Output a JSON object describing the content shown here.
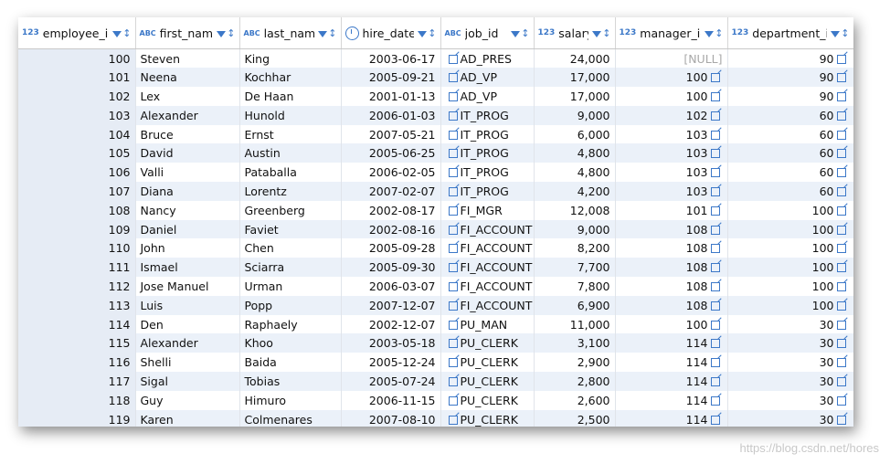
{
  "table": {
    "columns": [
      {
        "name": "employee_id",
        "type_icon": "123",
        "icon_kind": "numeric-type-icon"
      },
      {
        "name": "first_name",
        "type_icon": "ABC",
        "icon_kind": "text-type-icon"
      },
      {
        "name": "last_name",
        "type_icon": "ABC",
        "icon_kind": "text-key-type-icon"
      },
      {
        "name": "hire_date",
        "type_icon": "",
        "icon_kind": "clock-icon"
      },
      {
        "name": "job_id",
        "type_icon": "ABC",
        "icon_kind": "text-key-type-icon"
      },
      {
        "name": "salary",
        "type_icon": "123",
        "icon_kind": "numeric-type-icon"
      },
      {
        "name": "manager_id",
        "type_icon": "123",
        "icon_kind": "numeric-key-type-icon"
      },
      {
        "name": "department_id",
        "type_icon": "123",
        "icon_kind": "numeric-key-type-icon"
      }
    ],
    "rows": [
      {
        "employee_id": "100",
        "first_name": "Steven",
        "last_name": "King",
        "hire_date": "2003-06-17",
        "job_id": "AD_PRES",
        "salary": "24,000",
        "manager_id": "[NULL]",
        "department_id": "90"
      },
      {
        "employee_id": "101",
        "first_name": "Neena",
        "last_name": "Kochhar",
        "hire_date": "2005-09-21",
        "job_id": "AD_VP",
        "salary": "17,000",
        "manager_id": "100",
        "department_id": "90"
      },
      {
        "employee_id": "102",
        "first_name": "Lex",
        "last_name": "De Haan",
        "hire_date": "2001-01-13",
        "job_id": "AD_VP",
        "salary": "17,000",
        "manager_id": "100",
        "department_id": "90"
      },
      {
        "employee_id": "103",
        "first_name": "Alexander",
        "last_name": "Hunold",
        "hire_date": "2006-01-03",
        "job_id": "IT_PROG",
        "salary": "9,000",
        "manager_id": "102",
        "department_id": "60"
      },
      {
        "employee_id": "104",
        "first_name": "Bruce",
        "last_name": "Ernst",
        "hire_date": "2007-05-21",
        "job_id": "IT_PROG",
        "salary": "6,000",
        "manager_id": "103",
        "department_id": "60"
      },
      {
        "employee_id": "105",
        "first_name": "David",
        "last_name": "Austin",
        "hire_date": "2005-06-25",
        "job_id": "IT_PROG",
        "salary": "4,800",
        "manager_id": "103",
        "department_id": "60"
      },
      {
        "employee_id": "106",
        "first_name": "Valli",
        "last_name": "Pataballa",
        "hire_date": "2006-02-05",
        "job_id": "IT_PROG",
        "salary": "4,800",
        "manager_id": "103",
        "department_id": "60"
      },
      {
        "employee_id": "107",
        "first_name": "Diana",
        "last_name": "Lorentz",
        "hire_date": "2007-02-07",
        "job_id": "IT_PROG",
        "salary": "4,200",
        "manager_id": "103",
        "department_id": "60"
      },
      {
        "employee_id": "108",
        "first_name": "Nancy",
        "last_name": "Greenberg",
        "hire_date": "2002-08-17",
        "job_id": "FI_MGR",
        "salary": "12,008",
        "manager_id": "101",
        "department_id": "100"
      },
      {
        "employee_id": "109",
        "first_name": "Daniel",
        "last_name": "Faviet",
        "hire_date": "2002-08-16",
        "job_id": "FI_ACCOUNT",
        "salary": "9,000",
        "manager_id": "108",
        "department_id": "100"
      },
      {
        "employee_id": "110",
        "first_name": "John",
        "last_name": "Chen",
        "hire_date": "2005-09-28",
        "job_id": "FI_ACCOUNT",
        "salary": "8,200",
        "manager_id": "108",
        "department_id": "100"
      },
      {
        "employee_id": "111",
        "first_name": "Ismael",
        "last_name": "Sciarra",
        "hire_date": "2005-09-30",
        "job_id": "FI_ACCOUNT",
        "salary": "7,700",
        "manager_id": "108",
        "department_id": "100"
      },
      {
        "employee_id": "112",
        "first_name": "Jose Manuel",
        "last_name": "Urman",
        "hire_date": "2006-03-07",
        "job_id": "FI_ACCOUNT",
        "salary": "7,800",
        "manager_id": "108",
        "department_id": "100"
      },
      {
        "employee_id": "113",
        "first_name": "Luis",
        "last_name": "Popp",
        "hire_date": "2007-12-07",
        "job_id": "FI_ACCOUNT",
        "salary": "6,900",
        "manager_id": "108",
        "department_id": "100"
      },
      {
        "employee_id": "114",
        "first_name": "Den",
        "last_name": "Raphaely",
        "hire_date": "2002-12-07",
        "job_id": "PU_MAN",
        "salary": "11,000",
        "manager_id": "100",
        "department_id": "30"
      },
      {
        "employee_id": "115",
        "first_name": "Alexander",
        "last_name": "Khoo",
        "hire_date": "2003-05-18",
        "job_id": "PU_CLERK",
        "salary": "3,100",
        "manager_id": "114",
        "department_id": "30"
      },
      {
        "employee_id": "116",
        "first_name": "Shelli",
        "last_name": "Baida",
        "hire_date": "2005-12-24",
        "job_id": "PU_CLERK",
        "salary": "2,900",
        "manager_id": "114",
        "department_id": "30"
      },
      {
        "employee_id": "117",
        "first_name": "Sigal",
        "last_name": "Tobias",
        "hire_date": "2005-07-24",
        "job_id": "PU_CLERK",
        "salary": "2,800",
        "manager_id": "114",
        "department_id": "30"
      },
      {
        "employee_id": "118",
        "first_name": "Guy",
        "last_name": "Himuro",
        "hire_date": "2006-11-15",
        "job_id": "PU_CLERK",
        "salary": "2,600",
        "manager_id": "114",
        "department_id": "30"
      },
      {
        "employee_id": "119",
        "first_name": "Karen",
        "last_name": "Colmenares",
        "hire_date": "2007-08-10",
        "job_id": "PU_CLERK",
        "salary": "2,500",
        "manager_id": "114",
        "department_id": "30"
      }
    ]
  },
  "watermark": "https://blog.csdn.net/hores",
  "colors": {
    "accent": "#3c78c8",
    "row_alt": "#ebf1f9",
    "null_text": "#a8a8a8"
  }
}
